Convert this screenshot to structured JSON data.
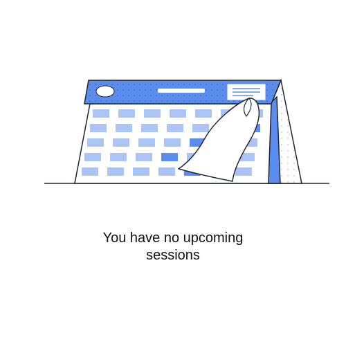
{
  "empty_state": {
    "illustration_icon": "calendar-page-flip-icon",
    "message_line1": "You have no upcoming",
    "message_line2": "sessions"
  },
  "colors": {
    "accent_blue": "#5b8def",
    "cell_light": "#a9c4f5",
    "cell_dark": "#5b8def",
    "outline": "#1f2430",
    "background": "#ffffff"
  }
}
